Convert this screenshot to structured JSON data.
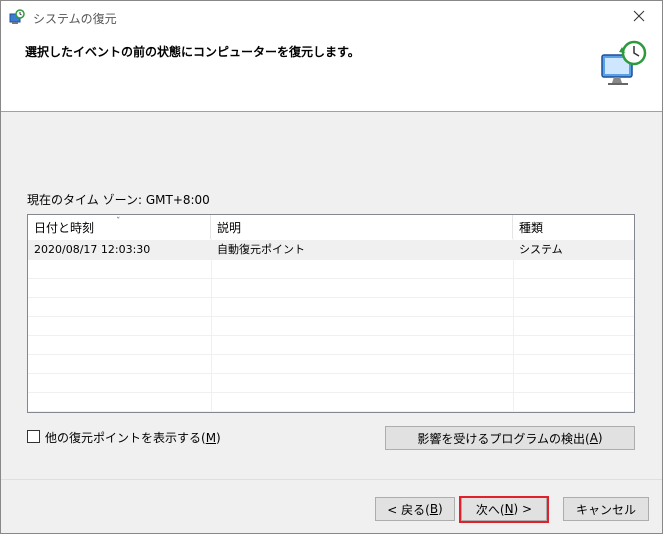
{
  "window": {
    "title": "システムの復元",
    "header_text": "選択したイベントの前の状態にコンピューターを復元します。"
  },
  "timezone_label": "現在のタイム ゾーン: GMT+8:00",
  "table": {
    "columns": [
      "日付と時刻",
      "説明",
      "種類"
    ],
    "rows": [
      {
        "datetime": "2020/08/17 12:03:30",
        "description": "自動復元ポイント",
        "type": "システム"
      }
    ],
    "sort_indicator": "ˇ"
  },
  "show_more": {
    "label_prefix": "他の復元ポイントを表示する(",
    "accel": "M",
    "label_suffix": ")",
    "checked": false
  },
  "affected_button": {
    "prefix": "影響を受けるプログラムの検出(",
    "accel": "A",
    "suffix": ")"
  },
  "buttons": {
    "back": {
      "prefix": "< 戻る(",
      "accel": "B",
      "suffix": ")"
    },
    "next": {
      "prefix": "次へ(",
      "accel": "N",
      "suffix": ") >"
    },
    "cancel": "キャンセル"
  },
  "icons": {
    "title": "system-restore-icon",
    "header": "computer-clock-icon",
    "close": "close-icon"
  },
  "colors": {
    "highlight": "#e0202a",
    "accent": "#2e9a3e"
  }
}
